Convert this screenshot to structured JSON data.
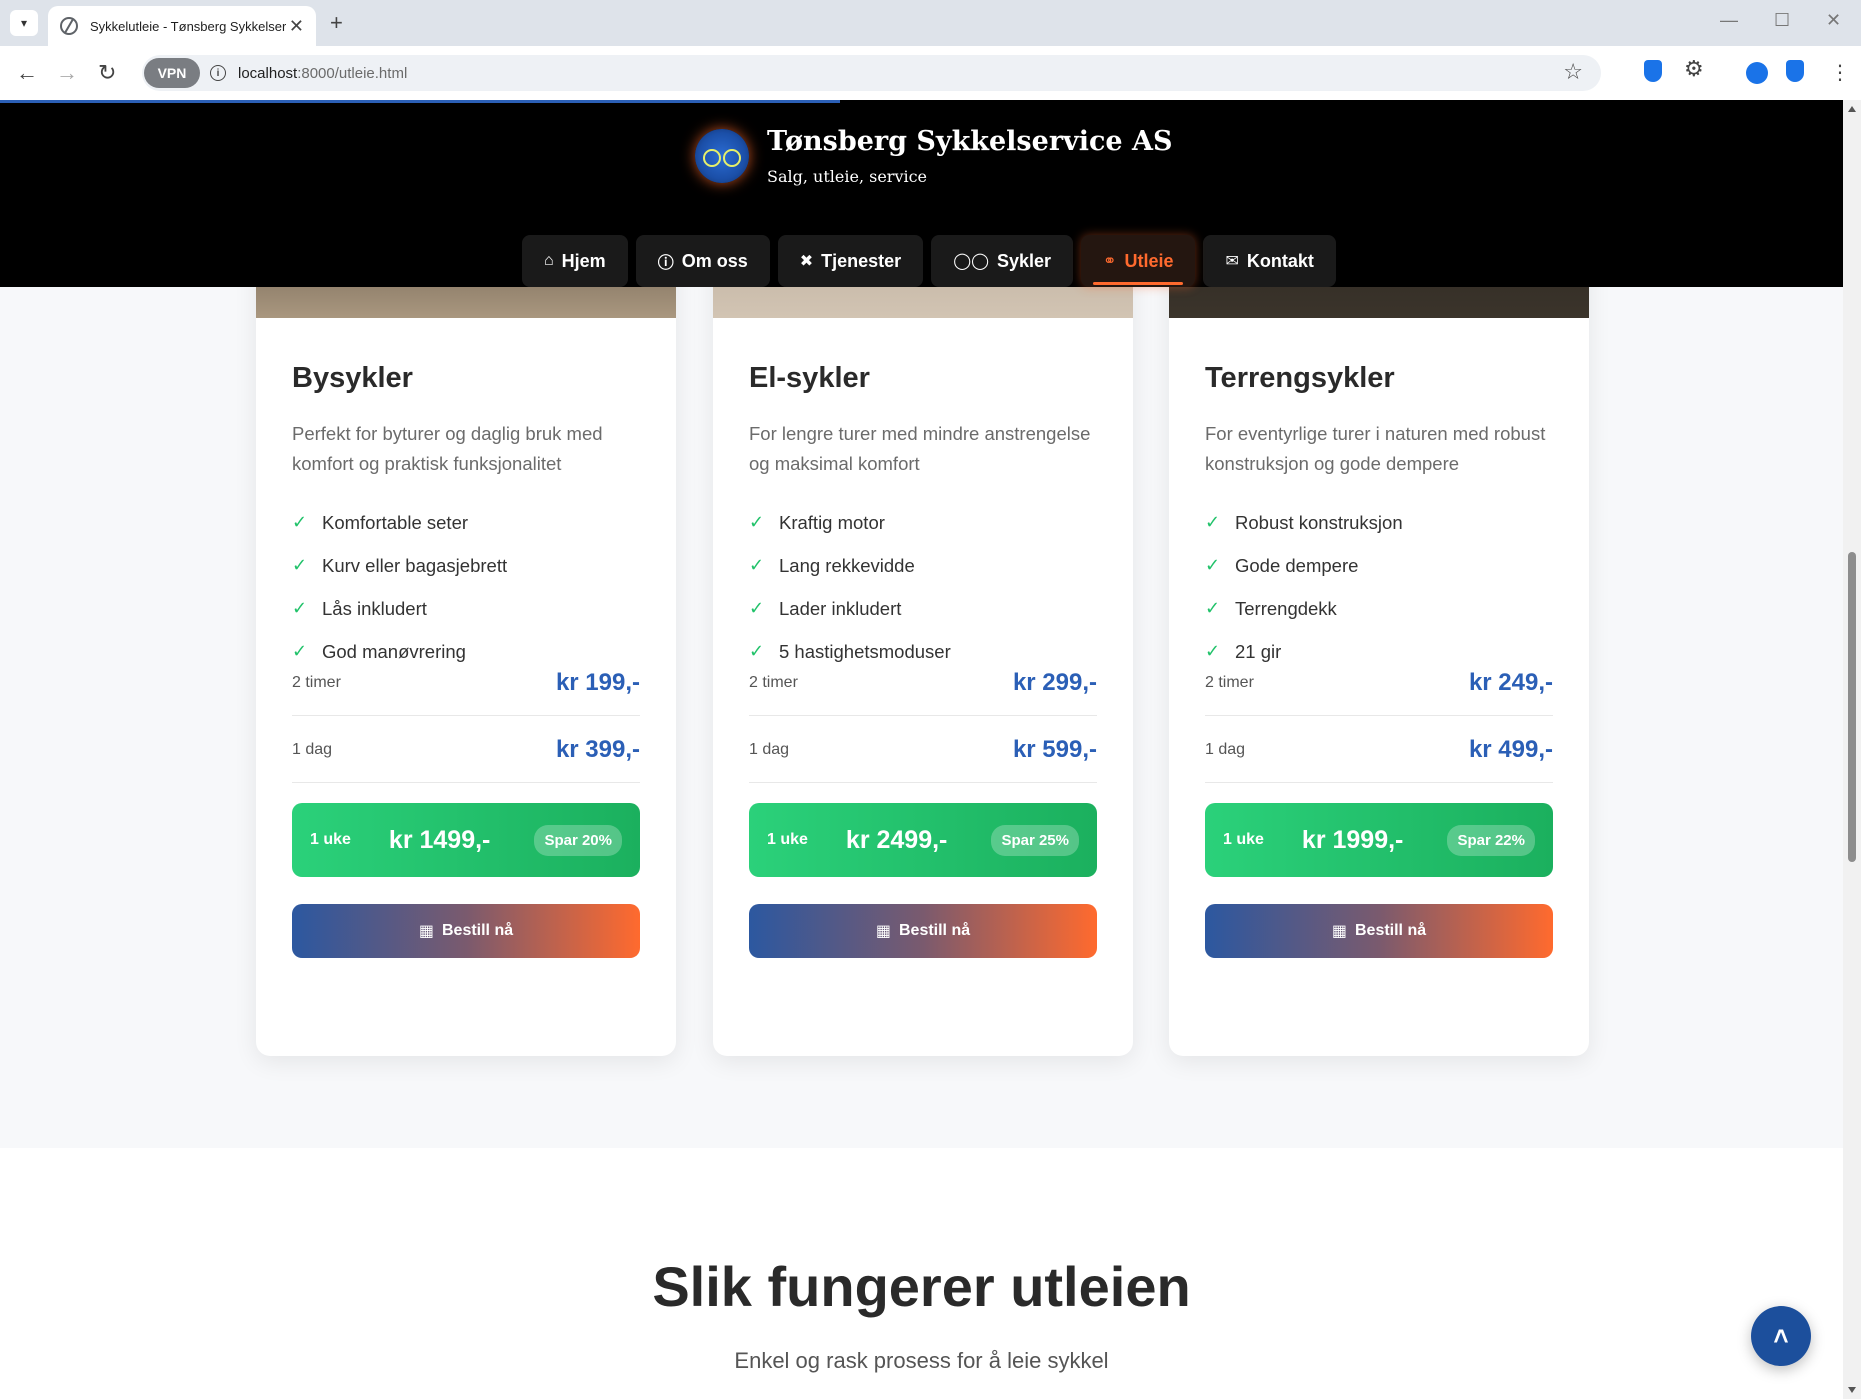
{
  "browser": {
    "tab_title": "Sykkelutleie - Tønsberg Sykkelservice AS",
    "url_host": "localhost",
    "url_rest": ":8000/utleie.html",
    "vpn_label": "VPN"
  },
  "site": {
    "title": "Tønsberg Sykkelservice AS",
    "subtitle": "Salg, utleie, service",
    "nav": [
      {
        "label": "Hjem",
        "icon": "home-icon"
      },
      {
        "label": "Om oss",
        "icon": "info-icon"
      },
      {
        "label": "Tjenester",
        "icon": "tools-icon"
      },
      {
        "label": "Sykler",
        "icon": "bicycle-icon"
      },
      {
        "label": "Utleie",
        "icon": "key-icon",
        "active": true
      },
      {
        "label": "Kontakt",
        "icon": "envelope-icon"
      }
    ]
  },
  "cards": [
    {
      "title": "Bysykler",
      "description": "Perfekt for byturer og daglig bruk med komfort og praktisk funksjonalitet",
      "features": [
        "Komfortable seter",
        "Kurv eller bagasjebrett",
        "Lås inkludert",
        "God manøvrering"
      ],
      "price_2h_label": "2 timer",
      "price_2h": "kr 199,-",
      "price_day_label": "1 dag",
      "price_day": "kr 399,-",
      "week_label": "1 uke",
      "week_price": "kr 1499,-",
      "save": "Spar 20%",
      "button": "Bestill nå"
    },
    {
      "title": "El-sykler",
      "description": "For lengre turer med mindre anstrengelse og maksimal komfort",
      "features": [
        "Kraftig motor",
        "Lang rekkevidde",
        "Lader inkludert",
        "5 hastighetsmoduser"
      ],
      "price_2h_label": "2 timer",
      "price_2h": "kr 299,-",
      "price_day_label": "1 dag",
      "price_day": "kr 599,-",
      "week_label": "1 uke",
      "week_price": "kr 2499,-",
      "save": "Spar 25%",
      "button": "Bestill nå"
    },
    {
      "title": "Terrengsykler",
      "description": "For eventyrlige turer i naturen med robust konstruksjon og gode dempere",
      "features": [
        "Robust konstruksjon",
        "Gode dempere",
        "Terrengdekk",
        "21 gir"
      ],
      "price_2h_label": "2 timer",
      "price_2h": "kr 249,-",
      "price_day_label": "1 dag",
      "price_day": "kr 499,-",
      "week_label": "1 uke",
      "week_price": "kr 1999,-",
      "save": "Spar 22%",
      "button": "Bestill nå"
    }
  ],
  "how": {
    "title": "Slik fungerer utleien",
    "subtitle": "Enkel og rask prosess for å leie sykkel"
  },
  "colors": {
    "accent": "#2b5fb6",
    "active_nav": "#ff6a2e",
    "check": "#21c26a",
    "week_green": "#1bb05e"
  }
}
